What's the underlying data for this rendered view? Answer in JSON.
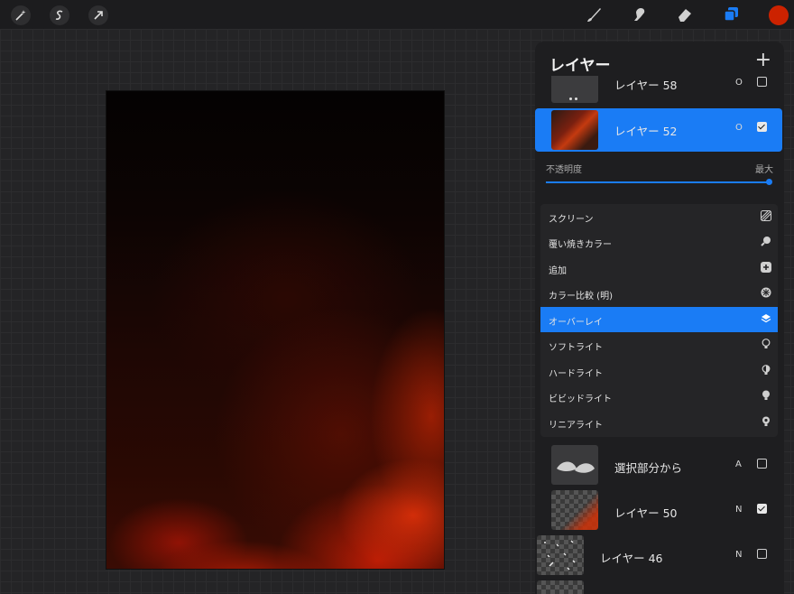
{
  "toolbar": {
    "left_tools": [
      "magic-wand-icon",
      "selection-icon",
      "transform-icon"
    ],
    "right_tools": [
      "brush-icon",
      "smudge-icon",
      "eraser-icon",
      "layers-icon"
    ],
    "current_color": "#cc2200",
    "accent": "#1a7cf5"
  },
  "layers_panel": {
    "title": "レイヤー",
    "add_label": "+",
    "partial_top_layer": {
      "name": "レイヤー 58",
      "mode": "O"
    },
    "selected_layer": {
      "name": "レイヤー 52",
      "mode": "O",
      "visible": true
    },
    "opacity_label": "不透明度",
    "opacity_max_label": "最大",
    "opacity_value": 1.0,
    "blend_modes": [
      {
        "label": "スクリーン",
        "icon": "diagonal-lines-icon",
        "active": false
      },
      {
        "label": "覆い焼きカラー",
        "icon": "magnifier-icon",
        "active": false
      },
      {
        "label": "追加",
        "icon": "plus-square-icon",
        "active": false
      },
      {
        "label": "カラー比較 (明)",
        "icon": "compare-circle-icon",
        "active": false
      },
      {
        "label": "オーバーレイ",
        "icon": "layers-stack-icon",
        "active": true
      },
      {
        "label": "ソフトライト",
        "icon": "bulb-outline-icon",
        "active": false
      },
      {
        "label": "ハードライト",
        "icon": "bulb-half-icon",
        "active": false
      },
      {
        "label": "ビビッドライト",
        "icon": "bulb-filled-icon",
        "active": false
      },
      {
        "label": "リニアライト",
        "icon": "bulb-dark-icon",
        "active": false
      }
    ],
    "layers": [
      {
        "name": "選択部分から",
        "mode": "A",
        "visible": false
      },
      {
        "name": "レイヤー 50",
        "mode": "N",
        "visible": true
      },
      {
        "name": "レイヤー 46",
        "mode": "N",
        "visible": false
      }
    ]
  }
}
